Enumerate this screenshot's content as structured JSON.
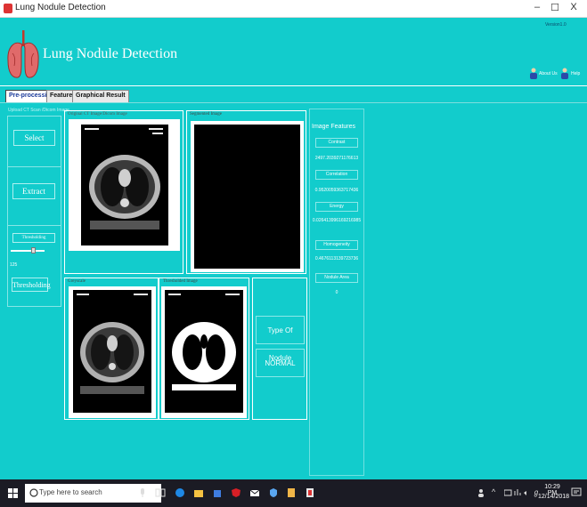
{
  "window": {
    "title": "Lung Nodule Detection",
    "controls": [
      "–",
      "☐",
      "X"
    ]
  },
  "app": {
    "version": "Version1.0",
    "title": "Lung Nodule Detection",
    "about_label": "About Us",
    "help_label": "Help"
  },
  "tabs": [
    {
      "label": "Pre-processing",
      "active": true
    },
    {
      "label": "Features",
      "active": false
    },
    {
      "label": "Graphical Result",
      "active": false
    }
  ],
  "left": {
    "upload_label": "Upload CT Scan /Dicom Image",
    "select_label": "Select",
    "extract_label": "Extract",
    "thresholding_small_label": "Thresholding",
    "slider_value": "125",
    "thresholding_button_label": "Thresholding"
  },
  "images": {
    "original": "Original CT Image/Dicom Image",
    "segmented": "Segmented Image",
    "greyscale": "Greyscale",
    "thresholded": "Thresholded Image"
  },
  "features": {
    "title": "Image Features",
    "items": [
      {
        "label": "Contrast",
        "value": "2497.2039271176613"
      },
      {
        "label": "Correlation",
        "value": "0.9520059363717436"
      },
      {
        "label": "Energy",
        "value": "0.026413996169216985"
      },
      {
        "label": "Homogeneity",
        "value": "0.4676113139723736"
      },
      {
        "label": "Nodule Area",
        "value": "0"
      }
    ]
  },
  "result": {
    "type_label": "Type Of Nodule",
    "type_value": "NORMAL"
  },
  "taskbar": {
    "search_placeholder": "Type here to search",
    "time": "10:29 PM",
    "date": "12/14/2018"
  },
  "colors": {
    "app_background": "#12cccc",
    "taskbar": "#1b1b24"
  }
}
